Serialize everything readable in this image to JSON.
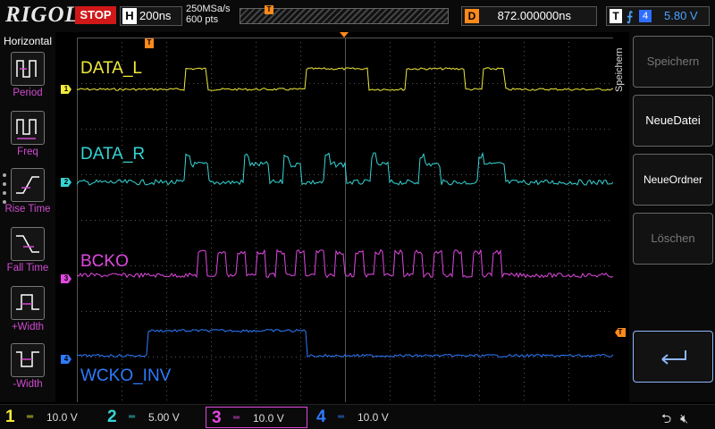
{
  "header": {
    "brand": "RIGOL",
    "run_state": "STOP",
    "timebase_key": "H",
    "timebase": "200ns",
    "sample_rate": "250MSa/s",
    "memory_depth": "600 pts",
    "trigger_marker": "T",
    "delay_key": "D",
    "delay_value": "872.000000ns",
    "trigger_key": "T",
    "trigger_edge": "rising",
    "trigger_source": "4",
    "trigger_level": "5.80 V"
  },
  "left_menu": {
    "title": "Horizontal",
    "items": [
      {
        "label": "Period",
        "icon": "period-icon"
      },
      {
        "label": "Freq",
        "icon": "freq-icon"
      },
      {
        "label": "Rise Time",
        "icon": "rise-time-icon"
      },
      {
        "label": "Fall Time",
        "icon": "fall-time-icon"
      },
      {
        "label": "+Width",
        "icon": "positive-width-icon"
      },
      {
        "label": "-Width",
        "icon": "negative-width-icon"
      }
    ]
  },
  "traces": [
    {
      "channel": "1",
      "label": "DATA_L",
      "color": "#f0ea3a"
    },
    {
      "channel": "2",
      "label": "DATA_R",
      "color": "#36d4d4"
    },
    {
      "channel": "3",
      "label": "BCKO",
      "color": "#e048e0"
    },
    {
      "channel": "4",
      "label": "WCKO_INV",
      "color": "#2e7bff"
    }
  ],
  "right_menu": {
    "title": "Speichern",
    "softkeys": [
      {
        "label": "Speichern",
        "enabled": false
      },
      {
        "label": "NeueDatei",
        "enabled": true
      },
      {
        "label": "NeueOrdner",
        "enabled": true
      },
      {
        "label": "Löschen",
        "enabled": false
      },
      {
        "label": "",
        "enabled": true,
        "icon": "return-arrow-icon"
      }
    ]
  },
  "channel_bar": [
    {
      "channel": "1",
      "scale": "10.0 V",
      "color": "#f0ea3a"
    },
    {
      "channel": "2",
      "scale": "5.00 V",
      "color": "#36d4d4"
    },
    {
      "channel": "3",
      "scale": "10.0 V",
      "color": "#e048e0"
    },
    {
      "channel": "4",
      "scale": "10.0 V",
      "color": "#2e7bff"
    }
  ],
  "status": {
    "usb_icon": "usb-icon",
    "speaker_icon": "speaker-muted-icon"
  }
}
